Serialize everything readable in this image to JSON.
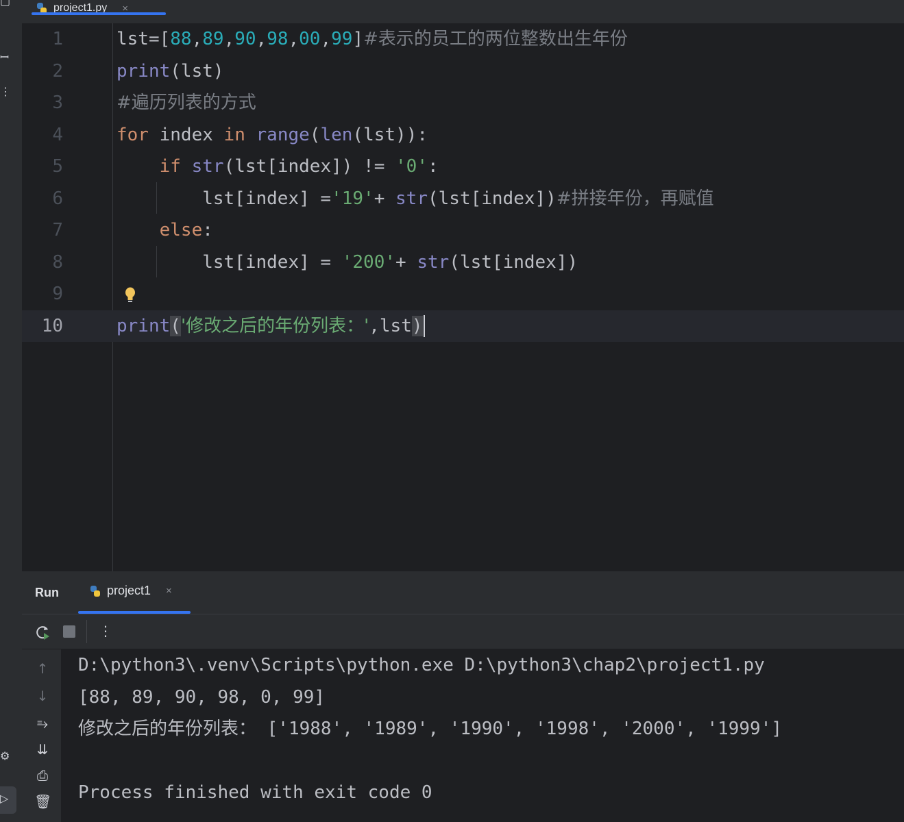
{
  "editor_tab": {
    "filename": "project1.py",
    "close": "×"
  },
  "code_lines": [
    {
      "num": "1",
      "tokens": [
        {
          "t": "lst=[",
          "c": ""
        },
        {
          "t": "88",
          "c": "num"
        },
        {
          "t": ",",
          "c": ""
        },
        {
          "t": "89",
          "c": "num"
        },
        {
          "t": ",",
          "c": ""
        },
        {
          "t": "90",
          "c": "num"
        },
        {
          "t": ",",
          "c": ""
        },
        {
          "t": "98",
          "c": "num"
        },
        {
          "t": ",",
          "c": ""
        },
        {
          "t": "00",
          "c": "num"
        },
        {
          "t": ",",
          "c": ""
        },
        {
          "t": "99",
          "c": "num"
        },
        {
          "t": "]",
          "c": ""
        },
        {
          "t": "#表示的员工的两位整数出生年份",
          "c": "cmt cjk"
        }
      ]
    },
    {
      "num": "2",
      "tokens": [
        {
          "t": "print",
          "c": "bi"
        },
        {
          "t": "(lst)",
          "c": ""
        }
      ]
    },
    {
      "num": "3",
      "tokens": [
        {
          "t": "#遍历列表的方式",
          "c": "cmt cjk"
        }
      ]
    },
    {
      "num": "4",
      "tokens": [
        {
          "t": "for",
          "c": "kw"
        },
        {
          "t": " index ",
          "c": ""
        },
        {
          "t": "in",
          "c": "kw"
        },
        {
          "t": " ",
          "c": ""
        },
        {
          "t": "range",
          "c": "bi"
        },
        {
          "t": "(",
          "c": ""
        },
        {
          "t": "len",
          "c": "bi"
        },
        {
          "t": "(lst)):",
          "c": ""
        }
      ]
    },
    {
      "num": "5",
      "tokens": [
        {
          "t": "    ",
          "c": ""
        },
        {
          "t": "if",
          "c": "kw"
        },
        {
          "t": " ",
          "c": ""
        },
        {
          "t": "str",
          "c": "bi"
        },
        {
          "t": "(lst[index]) != ",
          "c": ""
        },
        {
          "t": "'0'",
          "c": "str"
        },
        {
          "t": ":",
          "c": ""
        }
      ]
    },
    {
      "num": "6",
      "tokens": [
        {
          "t": "        lst[index] =",
          "c": ""
        },
        {
          "t": "'19'",
          "c": "str"
        },
        {
          "t": "+ ",
          "c": ""
        },
        {
          "t": "str",
          "c": "bi"
        },
        {
          "t": "(lst[index])",
          "c": ""
        },
        {
          "t": "#拼接年份，再赋值",
          "c": "cmt cjk"
        }
      ]
    },
    {
      "num": "7",
      "tokens": [
        {
          "t": "    ",
          "c": ""
        },
        {
          "t": "else",
          "c": "kw"
        },
        {
          "t": ":",
          "c": ""
        }
      ]
    },
    {
      "num": "8",
      "tokens": [
        {
          "t": "        lst[index] = ",
          "c": ""
        },
        {
          "t": "'200'",
          "c": "str"
        },
        {
          "t": "+ ",
          "c": ""
        },
        {
          "t": "str",
          "c": "bi"
        },
        {
          "t": "(lst[index])",
          "c": ""
        }
      ]
    },
    {
      "num": "9",
      "tokens": []
    },
    {
      "num": "10",
      "tokens": [
        {
          "t": "print",
          "c": "bi"
        },
        {
          "t": "(",
          "c": "bracket-hl"
        },
        {
          "t": "'修改之后的年份列表：'",
          "c": "str cjk"
        },
        {
          "t": ",lst",
          "c": ""
        },
        {
          "t": ")",
          "c": "bracket-hl"
        }
      ]
    }
  ],
  "run_panel": {
    "title": "Run",
    "tab_label": "project1",
    "close": "×",
    "console_lines": [
      "D:\\python3\\.venv\\Scripts\\python.exe D:\\python3\\chap2\\project1.py",
      "[88, 89, 90, 98, 0, 99]",
      "修改之后的年份列表： ['1988', '1989', '1990', '1998', '2000', '1999']",
      "",
      "Process finished with exit code 0"
    ]
  },
  "colors": {
    "keyword": "#cf8e6d",
    "builtin": "#8888c6",
    "number": "#2aacb8",
    "string": "#6aab73",
    "comment": "#7a7e85",
    "accent": "#3574f0"
  }
}
